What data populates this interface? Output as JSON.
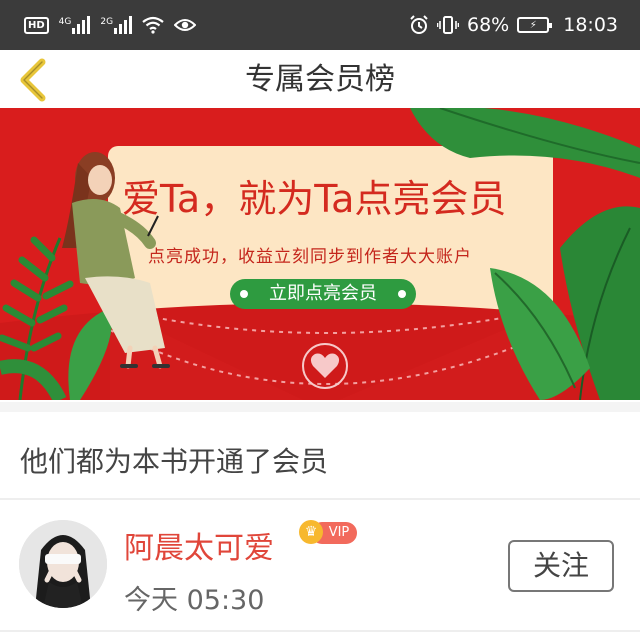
{
  "status_bar": {
    "hd_label": "HD",
    "network_1": "4G",
    "network_2": "2G",
    "battery_percent": "68%",
    "time": "18:03"
  },
  "header": {
    "title": "专属会员榜",
    "back_icon": "chevron-left-icon"
  },
  "banner": {
    "headline": "爱Ta，就为Ta点亮会员",
    "subtext": "点亮成功，收益立刻同步到作者大大账户",
    "button_label": "立即点亮会员",
    "colors": {
      "background": "#d91d1d",
      "card": "#fde8c8",
      "button": "#2e9b40",
      "leaf": "#2f8f3a"
    }
  },
  "section": {
    "heading": "他们都为本书开通了会员"
  },
  "members": [
    {
      "name": "阿晨太可爱",
      "badge": "VIP",
      "time": "今天 05:30",
      "follow_label": "关注"
    }
  ]
}
